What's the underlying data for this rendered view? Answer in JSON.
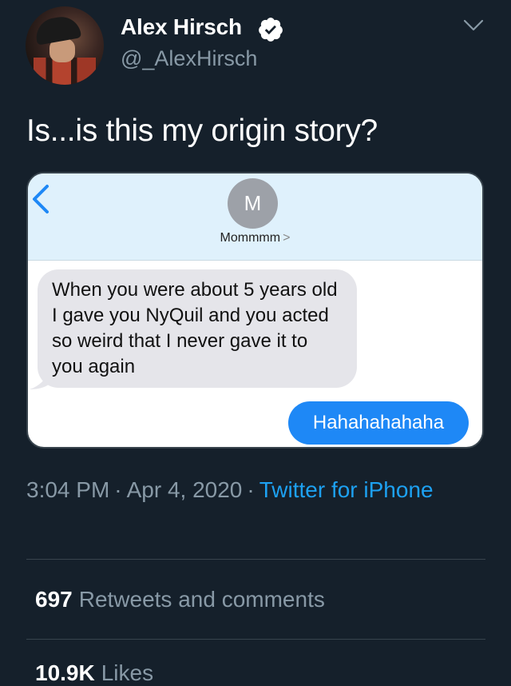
{
  "tweet": {
    "author_name": "Alex Hirsch",
    "author_handle": "@_AlexHirsch",
    "text": "Is...is this my origin story?",
    "time": "3:04 PM",
    "date": "Apr 4, 2020",
    "separator": "·",
    "source": "Twitter for iPhone"
  },
  "media": {
    "contact_initial": "M",
    "contact_name": "Mommmm",
    "contact_chevron": ">",
    "incoming_message": "When you were about 5 years old I gave you NyQuil and you acted so weird that I never gave it to you again",
    "outgoing_message": "Hahahahahaha"
  },
  "stats": {
    "retweets_count": "697",
    "retweets_label": "Retweets and comments",
    "likes_count": "10.9K",
    "likes_label": "Likes"
  },
  "colors": {
    "background": "#15202b",
    "accent": "#1da1f2",
    "secondary_text": "#8899a6",
    "bubble_out": "#1e88f6",
    "bubble_in": "#e5e5ea"
  },
  "icons": [
    "verified-badge-icon",
    "chevron-down-icon",
    "back-chevron-icon"
  ]
}
